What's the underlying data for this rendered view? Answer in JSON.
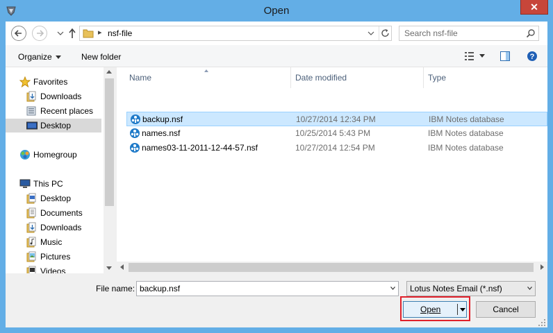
{
  "window": {
    "title": "Open",
    "close_label": "✕"
  },
  "address": {
    "path": "nsf-file",
    "search_placeholder": "Search nsf-file"
  },
  "toolbar": {
    "organize_label": "Organize",
    "new_folder_label": "New folder"
  },
  "sidebar": {
    "favorites_label": "Favorites",
    "favorites": [
      "Downloads",
      "Recent places",
      "Desktop"
    ],
    "homegroup_label": "Homegroup",
    "thispc_label": "This PC",
    "thispc": [
      "Desktop",
      "Documents",
      "Downloads",
      "Music",
      "Pictures",
      "Videos"
    ]
  },
  "columns": {
    "name": "Name",
    "date": "Date modified",
    "type": "Type"
  },
  "files": [
    {
      "name": "backup.nsf",
      "date": "10/27/2014 12:34 PM",
      "type": "IBM Notes database",
      "selected": true
    },
    {
      "name": "names.nsf",
      "date": "10/25/2014 5:43 PM",
      "type": "IBM Notes database",
      "selected": false
    },
    {
      "name": "names03-11-2011-12-44-57.nsf",
      "date": "10/27/2014 12:54 PM",
      "type": "IBM Notes database",
      "selected": false
    }
  ],
  "footer": {
    "filename_label": "File name:",
    "filename_value": "backup.nsf",
    "filetype_value": "Lotus Notes Email (*.nsf)",
    "open_label": "Open",
    "cancel_label": "Cancel"
  },
  "colors": {
    "accent": "#63aee6",
    "selection": "#cce8ff",
    "highlight": "#e0202a",
    "close": "#c7463a"
  }
}
